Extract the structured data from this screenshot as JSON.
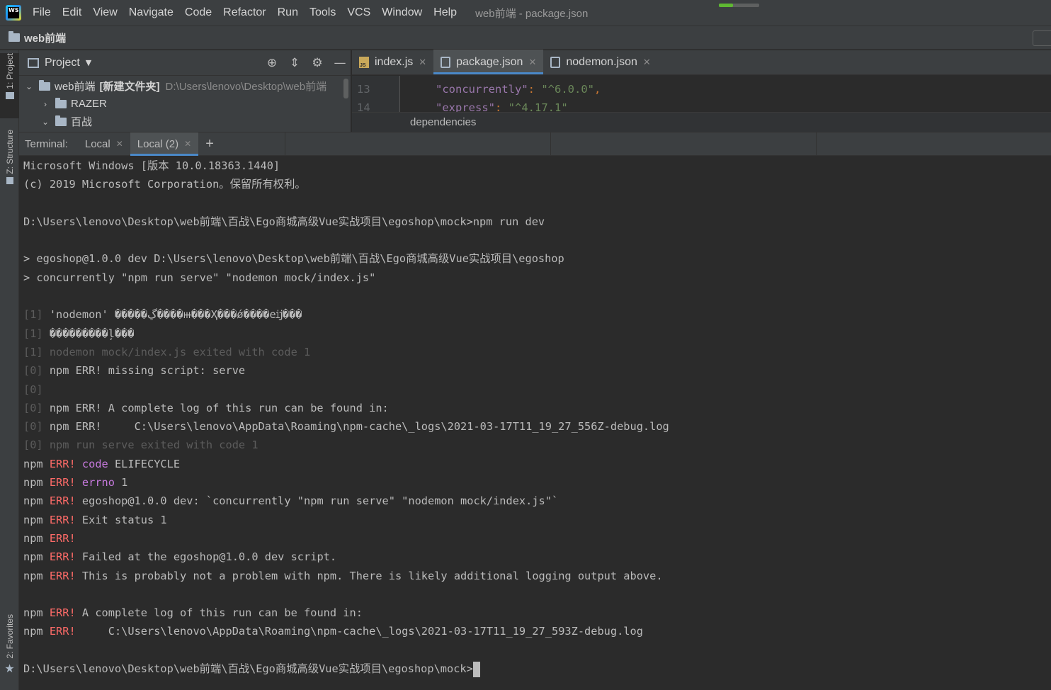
{
  "menubar": {
    "logo_text": "WS",
    "items": [
      "File",
      "Edit",
      "View",
      "Navigate",
      "Code",
      "Refactor",
      "Run",
      "Tools",
      "VCS",
      "Window",
      "Help"
    ],
    "window_title": "web前端 - package.json",
    "progress": 0.35,
    "progress_color": "#5fb832"
  },
  "navbar": {
    "crumb": "web前端"
  },
  "left_stripe": {
    "project": "1: Project",
    "structure": "Z: Structure",
    "favorites": "2: Favorites"
  },
  "project_panel": {
    "title": "Project",
    "tree": [
      {
        "name": "web前端",
        "tag": "[新建文件夹]",
        "path": "D:\\Users\\lenovo\\Desktop\\web前端"
      },
      {
        "name": "RAZER"
      },
      {
        "name": "百战"
      }
    ]
  },
  "editor": {
    "tabs": [
      {
        "label": "index.js",
        "type": "js"
      },
      {
        "label": "package.json",
        "type": "json"
      },
      {
        "label": "nodemon.json",
        "type": "json"
      }
    ],
    "lines": [
      {
        "num": "13",
        "key": "\"concurrently\"",
        "colon": ": ",
        "value": "\"^6.0.0\"",
        "comma": ","
      },
      {
        "num": "14",
        "key": "\"express\"",
        "colon": ": ",
        "value": "\"^4.17.1\"",
        "comma": ""
      }
    ],
    "breadcrumb": "dependencies"
  },
  "terminal": {
    "label": "Terminal:",
    "tabs": [
      "Local",
      "Local (2)"
    ],
    "lines": [
      {
        "parts": [
          {
            "t": "Microsoft Windows [版本 10.0.18363.1440]"
          }
        ]
      },
      {
        "parts": [
          {
            "t": "(c) 2019 Microsoft Corporation。保留所有权利。"
          }
        ]
      },
      {
        "parts": [
          {
            "t": ""
          }
        ]
      },
      {
        "parts": [
          {
            "t": "D:\\Users\\lenovo\\Desktop\\web前端\\百战\\Ego商城高级Vue实战项目\\egoshop\\mock>npm run dev"
          }
        ]
      },
      {
        "parts": [
          {
            "t": ""
          }
        ]
      },
      {
        "parts": [
          {
            "t": "> egoshop@1.0.0 dev D:\\Users\\lenovo\\Desktop\\web前端\\百战\\Ego商城高级Vue实战项目\\egoshop"
          }
        ]
      },
      {
        "parts": [
          {
            "t": "> concurrently \"npm run serve\" \"nodemon mock/index.js\""
          }
        ]
      },
      {
        "parts": [
          {
            "t": ""
          }
        ]
      },
      {
        "parts": [
          {
            "t": "[1] ",
            "c": "dim"
          },
          {
            "t": "'nodemon' �����ڲ����ⲿ���Ҳ���ǿ����еĳ���"
          }
        ]
      },
      {
        "parts": [
          {
            "t": "[1] ",
            "c": "dim"
          },
          {
            "t": "���������ļ���"
          }
        ]
      },
      {
        "parts": [
          {
            "t": "[1] nodemon mock/index.js exited with code 1",
            "c": "dim"
          }
        ]
      },
      {
        "parts": [
          {
            "t": "[0] ",
            "c": "dim"
          },
          {
            "t": "npm ERR! missing script: serve"
          }
        ]
      },
      {
        "parts": [
          {
            "t": "[0]",
            "c": "dim"
          }
        ]
      },
      {
        "parts": [
          {
            "t": "[0] ",
            "c": "dim"
          },
          {
            "t": "npm ERR! A complete log of this run can be found in:"
          }
        ]
      },
      {
        "parts": [
          {
            "t": "[0] ",
            "c": "dim"
          },
          {
            "t": "npm ERR!     C:\\Users\\lenovo\\AppData\\Roaming\\npm-cache\\_logs\\2021-03-17T11_19_27_556Z-debug.log"
          }
        ]
      },
      {
        "parts": [
          {
            "t": "[0] npm run serve exited with code 1",
            "c": "dim"
          }
        ]
      },
      {
        "parts": [
          {
            "t": "npm "
          },
          {
            "t": "ERR!",
            "c": "red"
          },
          {
            "t": " "
          },
          {
            "t": "code",
            "c": "magenta"
          },
          {
            "t": " ELIFECYCLE"
          }
        ]
      },
      {
        "parts": [
          {
            "t": "npm "
          },
          {
            "t": "ERR!",
            "c": "red"
          },
          {
            "t": " "
          },
          {
            "t": "errno",
            "c": "magenta"
          },
          {
            "t": " 1"
          }
        ]
      },
      {
        "parts": [
          {
            "t": "npm "
          },
          {
            "t": "ERR!",
            "c": "red"
          },
          {
            "t": " egoshop@1.0.0 dev: `concurrently \"npm run serve\" \"nodemon mock/index.js\"`"
          }
        ]
      },
      {
        "parts": [
          {
            "t": "npm "
          },
          {
            "t": "ERR!",
            "c": "red"
          },
          {
            "t": " Exit status 1"
          }
        ]
      },
      {
        "parts": [
          {
            "t": "npm "
          },
          {
            "t": "ERR!",
            "c": "red"
          }
        ]
      },
      {
        "parts": [
          {
            "t": "npm "
          },
          {
            "t": "ERR!",
            "c": "red"
          },
          {
            "t": " Failed at the egoshop@1.0.0 dev script."
          }
        ]
      },
      {
        "parts": [
          {
            "t": "npm "
          },
          {
            "t": "ERR!",
            "c": "red"
          },
          {
            "t": " This is probably not a problem with npm. There is likely additional logging output above."
          }
        ]
      },
      {
        "parts": [
          {
            "t": ""
          }
        ]
      },
      {
        "parts": [
          {
            "t": "npm "
          },
          {
            "t": "ERR!",
            "c": "red"
          },
          {
            "t": " A complete log of this run can be found in:"
          }
        ]
      },
      {
        "parts": [
          {
            "t": "npm "
          },
          {
            "t": "ERR!",
            "c": "red"
          },
          {
            "t": "     C:\\Users\\lenovo\\AppData\\Roaming\\npm-cache\\_logs\\2021-03-17T11_19_27_593Z-debug.log"
          }
        ]
      },
      {
        "parts": [
          {
            "t": ""
          }
        ]
      }
    ],
    "prompt": "D:\\Users\\lenovo\\Desktop\\web前端\\百战\\Ego商城高级Vue实战项目\\egoshop\\mock>"
  },
  "colors": {
    "error": "#ff6b68",
    "keyword": "#c679dd",
    "accent": "#4a88c7"
  }
}
